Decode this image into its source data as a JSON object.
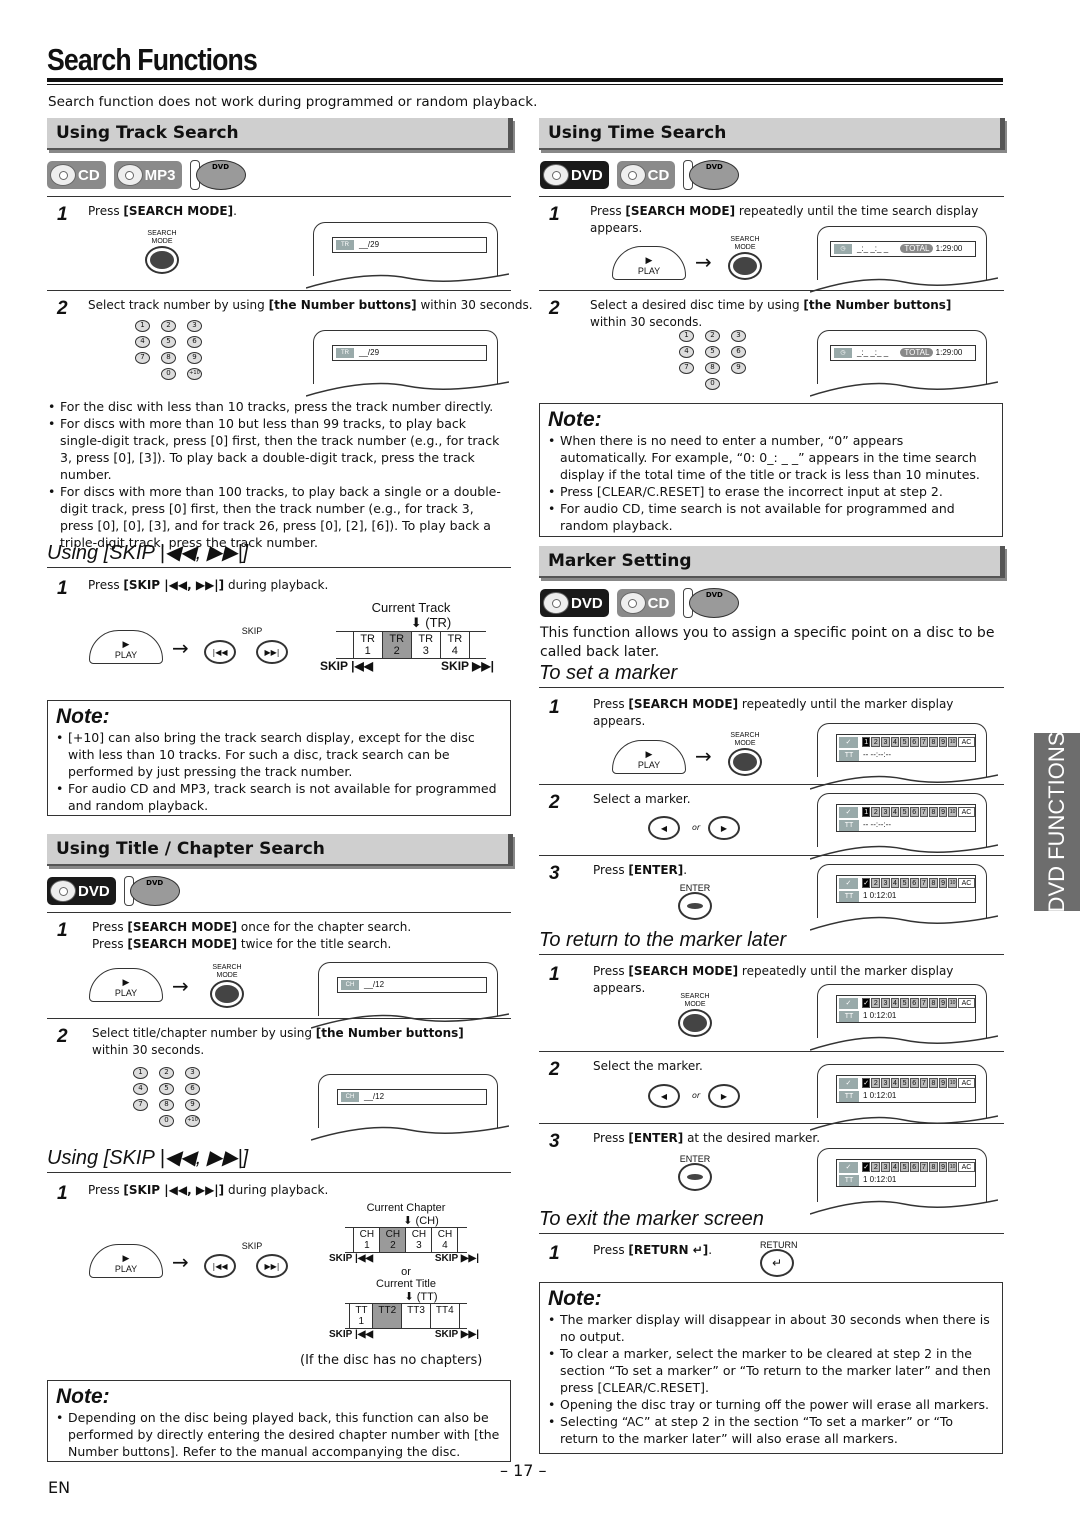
{
  "page": {
    "title": "Search Functions",
    "intro": "Search function does not work during programmed or random playback.",
    "page_number": "– 17 –",
    "language": "EN",
    "side_tab": "DVD FUNCTIONS"
  },
  "icons": {
    "cd": "CD",
    "mp3": "MP3",
    "dvd": "DVD",
    "dvd_small": "DVD"
  },
  "buttons": {
    "search_mode": "SEARCH\nMODE",
    "play": "PLAY",
    "skip": "SKIP",
    "enter": "ENTER",
    "return": "RETURN",
    "or": "or"
  },
  "track_search": {
    "heading": "Using Track Search",
    "step1_num": "1",
    "step1_pre": "Press ",
    "step1_bold": "[SEARCH MODE]",
    "step1_post": ".",
    "display1": "__/29",
    "display_tag": "TR",
    "step2_num": "2",
    "step2_pre": "Select track number by using ",
    "step2_bold": "[the Number buttons]",
    "step2_post": " within 30 seconds.",
    "display2": "__/29",
    "numpad": [
      "1",
      "2",
      "3",
      "4",
      "5",
      "6",
      "7",
      "8",
      "9",
      "",
      "0",
      "+10"
    ],
    "bullets": [
      "For the disc with less than 10 tracks, press the track number directly.",
      "For discs with more than 10 but less than 99 tracks, to play back single-digit track, press [0] first, then the track number (e.g., for track 3, press [0], [3]). To play back a double-digit track, press the track number.",
      "For discs with more than 100 tracks, to play back a single or a double-digit track, press [0] first, then the track number (e.g., for track 3, press [0], [0], [3], and for track 26, press [0], [2], [6]). To play back a triple-digit track, press the track number."
    ]
  },
  "skip_track": {
    "heading": "Using [SKIP |◀◀, ▶▶|]",
    "step1_num": "1",
    "step1_pre": "Press ",
    "step1_bold": "[SKIP |◀◀, ▶▶|]",
    "step1_post": " during playback.",
    "current_label": "Current Track",
    "current_abbr": "(TR)",
    "cells": [
      "TR 1",
      "TR 2",
      "TR 3",
      "TR 4"
    ],
    "current_index": 1,
    "skip_back": "SKIP |◀◀",
    "skip_fwd": "SKIP ▶▶|"
  },
  "note1": {
    "title": "Note:",
    "bullets": [
      "[+10] can also bring the track search display, except for the disc with less than 10 tracks. For such a disc, track search can be performed by just pressing the track number.",
      "For audio CD and MP3, track search is not available for programmed and random playback."
    ]
  },
  "title_chapter": {
    "heading": "Using Title / Chapter Search",
    "step1_num": "1",
    "step1_line1_pre": "Press ",
    "step1_line1_bold": "[SEARCH MODE]",
    "step1_line1_post": " once for the chapter search.",
    "step1_line2_pre": "Press ",
    "step1_line2_bold": "[SEARCH MODE]",
    "step1_line2_post": " twice for the title search.",
    "display1": "__/12",
    "display_tag": "CH",
    "step2_num": "2",
    "step2_pre": "Select title/chapter number by using ",
    "step2_bold": "[the Number buttons]",
    "step2_post": " within 30 seconds.",
    "display2": "__/12"
  },
  "skip_chapter": {
    "heading": "Using [SKIP |◀◀, ▶▶|]",
    "step1_num": "1",
    "step1_pre": "Press ",
    "step1_bold": "[SKIP |◀◀, ▶▶|]",
    "step1_post": " during playback.",
    "chapter_label": "Current Chapter",
    "chapter_abbr": "(CH)",
    "chapter_cells": [
      "CH 1",
      "CH 2",
      "CH 3",
      "CH 4"
    ],
    "title_label": "Current Title",
    "title_abbr": "(TT)",
    "title_cells": [
      "TT 1",
      "TT2",
      "TT3",
      "TT4"
    ],
    "current_index": 1,
    "or": "or",
    "skip_back": "SKIP |◀◀",
    "skip_fwd": "SKIP ▶▶|",
    "no_chapters": "(If the disc has no chapters)"
  },
  "note2": {
    "title": "Note:",
    "bullet": "Depending on the disc being played back, this function can also be performed by directly entering the desired chapter number with [the Number buttons]. Refer to the manual accompanying the disc."
  },
  "time_search": {
    "heading": "Using Time Search",
    "step1_num": "1",
    "step1_pre": "Press ",
    "step1_bold": "[SEARCH MODE]",
    "step1_post": " repeatedly until the time search display appears.",
    "display_time": "_:_ _:_ _",
    "display_total_label": "TOTAL",
    "display_total": "1:29:00",
    "step2_num": "2",
    "step2_pre": "Select a desired disc time by using ",
    "step2_bold": "[the Number buttons]",
    "step2_post": " within 30 seconds.",
    "numpad": [
      "1",
      "2",
      "3",
      "4",
      "5",
      "6",
      "7",
      "8",
      "9",
      "",
      "0",
      ""
    ]
  },
  "note3": {
    "title": "Note:",
    "bullets": [
      "When there is no need to enter a number, “0” appears automatically. For example, “0: 0_: _ _” appears in the time search display if the total time of the title or track is less than 10 minutes.",
      "Press [CLEAR/C.RESET] to erase the incorrect input at step 2.",
      "For audio CD, time search is not available for programmed and random playback."
    ]
  },
  "marker": {
    "heading": "Marker Setting",
    "description": "This function allows you to assign a specific point on a disc to be called back later.",
    "markers": [
      "1",
      "2",
      "3",
      "4",
      "5",
      "6",
      "7",
      "8",
      "9",
      "10",
      "AC"
    ],
    "empty_time": "-- --:--:--",
    "set_time": "1  0:12:01",
    "tt": "TT",
    "set": {
      "heading": "To set a marker",
      "steps": [
        {
          "num": "1",
          "pre": "Press ",
          "bold": "[SEARCH MODE]",
          "post": " repeatedly until the marker display appears."
        },
        {
          "num": "2",
          "pre": "Select a marker.",
          "bold": "",
          "post": ""
        },
        {
          "num": "3",
          "pre": "Press ",
          "bold": "[ENTER]",
          "post": "."
        }
      ]
    },
    "return": {
      "heading": "To return to the marker later",
      "steps": [
        {
          "num": "1",
          "pre": "Press ",
          "bold": "[SEARCH MODE]",
          "post": " repeatedly until the marker display appears."
        },
        {
          "num": "2",
          "pre": "Select the marker.",
          "bold": "",
          "post": ""
        },
        {
          "num": "3",
          "pre": "Press ",
          "bold": "[ENTER]",
          "post": " at the desired marker."
        }
      ]
    },
    "exit": {
      "heading": "To exit the marker screen",
      "step_num": "1",
      "pre": "Press ",
      "bold": "[RETURN ↵]",
      "post": "."
    }
  },
  "note4": {
    "title": "Note:",
    "bullets": [
      "The marker display will disappear in about 30 seconds when there is no output.",
      "To clear a marker, select the marker to be cleared at step 2 in the section “To set a marker” or “To return to the marker later” and then press [CLEAR/C.RESET].",
      "Opening the disc tray or turning off the power will erase all markers.",
      "Selecting “AC” at step 2 in the section “To set a marker” or “To return to the marker later” will also erase all markers."
    ]
  }
}
